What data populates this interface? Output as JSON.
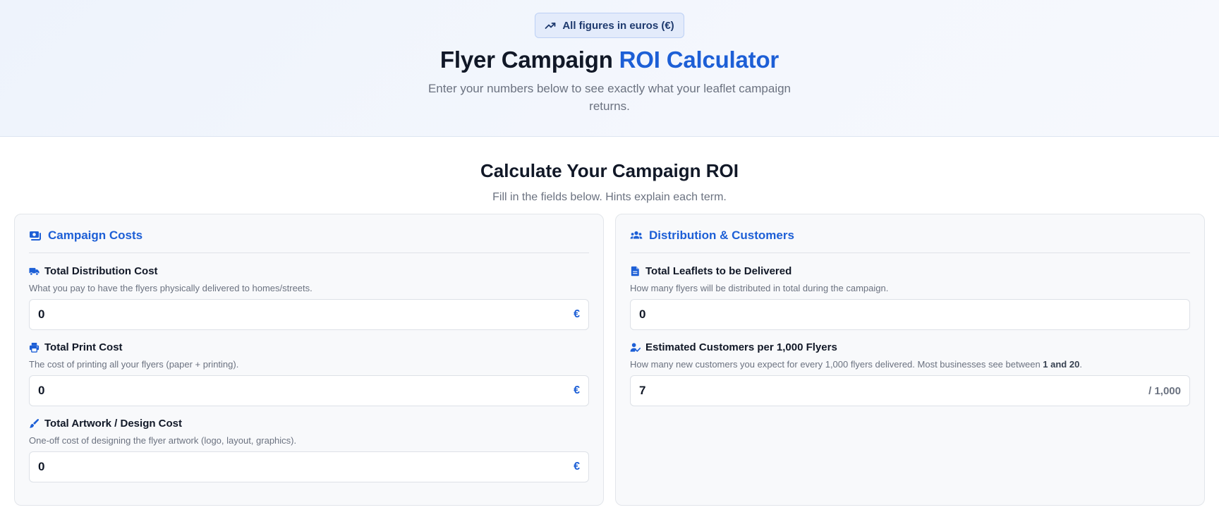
{
  "hero": {
    "badge_text": "All figures in euros (€)",
    "title_main": "Flyer Campaign ",
    "title_accent": "ROI Calculator",
    "subtitle": "Enter your numbers below to see exactly what your leaflet campaign returns."
  },
  "section": {
    "title": "Calculate Your Campaign ROI",
    "subtitle": "Fill in the fields below. Hints explain each term."
  },
  "colors": {
    "accent": "#1d5fd6",
    "heading": "#111827",
    "muted": "#6b7280"
  },
  "costs": {
    "title": "Campaign Costs",
    "icon": "money-bill-icon",
    "fields": [
      {
        "label": "Total Distribution Cost",
        "icon": "truck-icon",
        "hint": "What you pay to have the flyers physically delivered to homes/streets.",
        "value": "0",
        "suffix": "€"
      },
      {
        "label": "Total Print Cost",
        "icon": "printer-icon",
        "hint": "The cost of printing all your flyers (paper + printing).",
        "value": "0",
        "suffix": "€"
      },
      {
        "label": "Total Artwork / Design Cost",
        "icon": "paint-brush-icon",
        "hint": "One-off cost of designing the flyer artwork (logo, layout, graphics).",
        "value": "0",
        "suffix": "€"
      }
    ]
  },
  "distribution": {
    "title": "Distribution & Customers",
    "icon": "users-icon",
    "fields": [
      {
        "label": "Total Leaflets to be Delivered",
        "icon": "document-icon",
        "hint": "How many flyers will be distributed in total during the campaign.",
        "value": "0"
      },
      {
        "label": "Estimated Customers per 1,000 Flyers",
        "icon": "user-check-icon",
        "hint_prefix": "How many new customers you expect for every 1,000 flyers delivered. Most businesses see between ",
        "hint_bold": "1 and 20",
        "hint_suffix": ".",
        "value": "7",
        "suffix": "/ 1,000"
      }
    ]
  }
}
